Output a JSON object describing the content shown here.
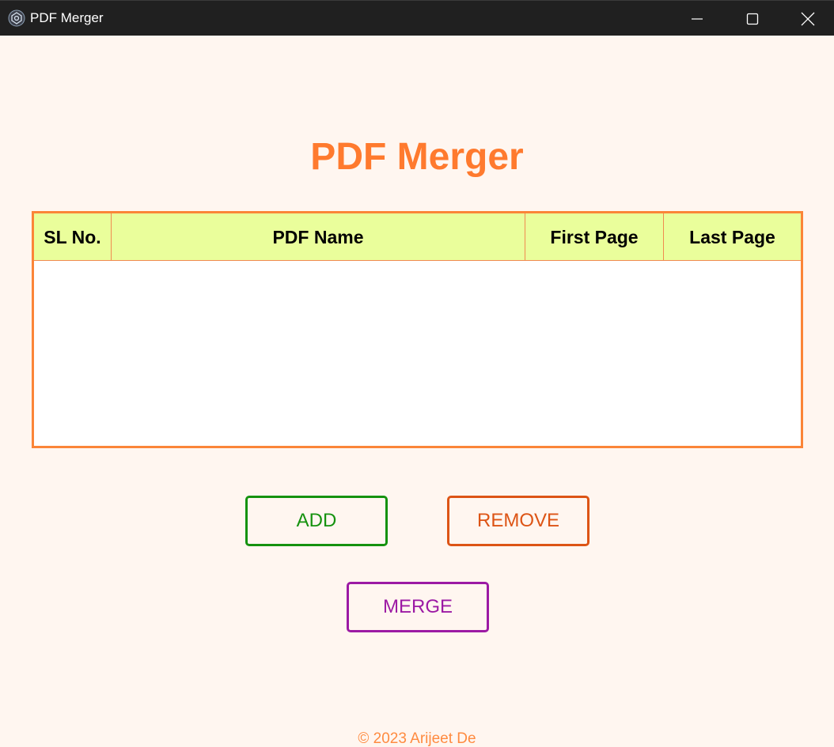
{
  "window": {
    "title": "PDF Merger",
    "icon": "app-gear-icon",
    "controls": [
      "minimize-icon",
      "maximize-icon",
      "close-icon"
    ]
  },
  "main": {
    "title": "PDF Merger",
    "table": {
      "columns": [
        "SL No.",
        "PDF Name",
        "First Page",
        "Last Page"
      ],
      "rows": []
    },
    "buttons": {
      "add": "ADD",
      "remove": "REMOVE",
      "merge": "MERGE"
    }
  },
  "footer": {
    "text": "© 2023 Arijeet De"
  },
  "colors": {
    "accent": "#ff7a2e",
    "table_border": "#fb8538",
    "header_bg": "#eafe9b",
    "add": "#15920f",
    "remove": "#dd5415",
    "merge": "#9c1aa4",
    "background": "#fff6f0"
  }
}
